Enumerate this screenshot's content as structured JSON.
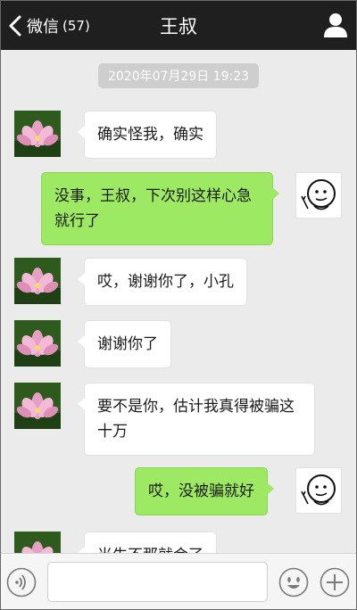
{
  "header": {
    "back_label": "微信",
    "unread_count": "(57)",
    "title": "王叔"
  },
  "timestamp": "2020年07月29日 19:23",
  "messages": [
    {
      "side": "in",
      "text": "确实怪我，确实"
    },
    {
      "side": "out",
      "text": "没事，王叔，下次别这样心急就行了"
    },
    {
      "side": "in",
      "text": "哎，谢谢你了，小孔"
    },
    {
      "side": "in",
      "text": "谢谢你了"
    },
    {
      "side": "in",
      "text": "要不是你，估计我真得被骗这十万"
    },
    {
      "side": "out",
      "text": "哎，没被骗就好"
    },
    {
      "side": "in",
      "text": "当生不那就会了"
    }
  ],
  "input": {
    "value": ""
  },
  "colors": {
    "header_bg": "#1f1f1f",
    "chat_bg": "#ebebeb",
    "sent_bubble": "#9ee964",
    "received_bubble": "#ffffff"
  },
  "icons": {
    "back": "chevron-left-icon",
    "profile": "person-icon",
    "voice": "voice-icon",
    "emoji": "smiley-icon",
    "plus": "plus-icon"
  }
}
